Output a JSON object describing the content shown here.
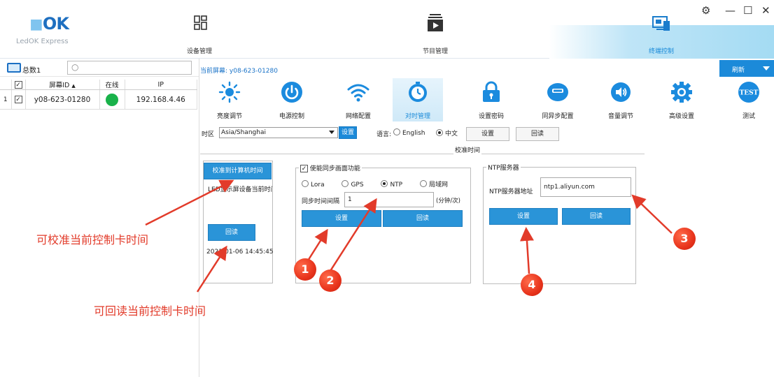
{
  "app": {
    "logo_text": "LedOK Express",
    "logo_mark": "OK"
  },
  "nav": [
    {
      "label": "设备管理"
    },
    {
      "label": "节目管理"
    },
    {
      "label": "终端控制"
    }
  ],
  "window_controls": {
    "settings": "⚙",
    "minimize": "—",
    "maximize": "☐",
    "close": "✕"
  },
  "left": {
    "total_label": "总数1",
    "columns": [
      "屏幕ID",
      "在线",
      "IP"
    ],
    "rows": [
      {
        "index": "1",
        "screen_id": "y08-623-01280",
        "ip": "192.168.4.46"
      }
    ]
  },
  "main": {
    "current_screen": "当前屏幕: y08-623-01280",
    "refresh_label": "刷新",
    "tools": [
      {
        "label": "亮度调节",
        "icon": "sun-icon"
      },
      {
        "label": "电源控制",
        "icon": "power-icon"
      },
      {
        "label": "网络配置",
        "icon": "wifi-icon"
      },
      {
        "label": "对时管理",
        "icon": "clock-icon"
      },
      {
        "label": "设置密码",
        "icon": "lock-icon"
      },
      {
        "label": "同异步配置",
        "icon": "sync-icon"
      },
      {
        "label": "音量调节",
        "icon": "volume-icon"
      },
      {
        "label": "高级设置",
        "icon": "gear-icon"
      },
      {
        "label": "测试",
        "icon": "test-icon"
      }
    ],
    "timezone_label": "时区",
    "timezone_value": "Asia/Shanghai",
    "set_label": "设置",
    "language_label": "语言:",
    "lang_english": "English",
    "lang_chinese": "中文",
    "set_btn": "设置",
    "readback_btn": "回读",
    "calib_title": "校准时间",
    "calibrate_pc_btn": "校准到计算机时间",
    "led_current_time_label": "LED显示屏设备当前时间",
    "readback_btn2": "回读",
    "led_time_value": "2021-01-06 14:45:45",
    "sync_group_label": "使能同步画面功能",
    "sync_options": [
      "Lora",
      "GPS",
      "NTP",
      "局域网"
    ],
    "sync_interval_label": "同步时间间隔",
    "sync_interval_value": "1",
    "sync_interval_unit": "(分钟/次)",
    "sync_set_btn": "设置",
    "sync_read_btn": "回读",
    "ntp_group_label": "NTP服务器",
    "ntp_addr_label": "NTP服务器地址",
    "ntp_addr_value": "ntp1.aliyun.com",
    "ntp_set_btn": "设置",
    "ntp_read_btn": "回读"
  },
  "annotations": {
    "note1": "可校准当前控制卡时间",
    "note2": "可回读当前控制卡时间",
    "markers": [
      "1",
      "2",
      "3",
      "4"
    ],
    "color": "#e23b2a"
  },
  "colors": {
    "accent": "#1c8ad9",
    "online": "#19b24a"
  }
}
